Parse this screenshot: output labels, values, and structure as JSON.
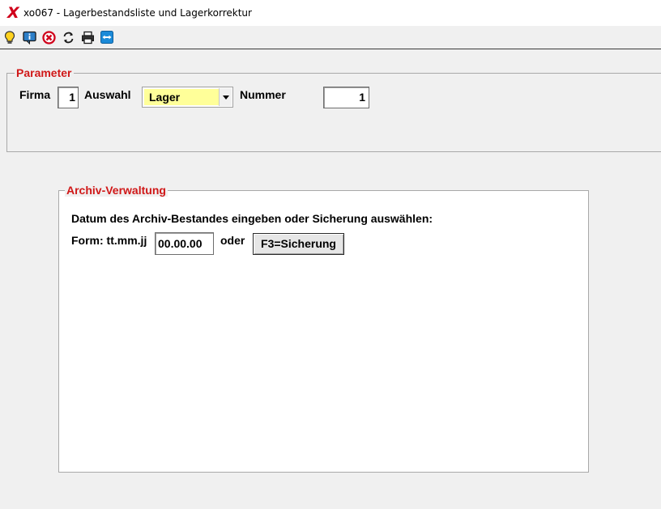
{
  "window": {
    "logo_glyph": "X",
    "title": "xo067 - Lagerbestandsliste und Lagerkorrektur"
  },
  "toolbar": {
    "icons": [
      "lightbulb-icon",
      "info-icon",
      "cancel-icon",
      "refresh-icon",
      "print-icon",
      "teamviewer-icon"
    ]
  },
  "parameter": {
    "legend": "Parameter",
    "firma_label": "Firma",
    "firma_value": "1",
    "auswahl_label": "Auswahl",
    "auswahl_value": "Lager",
    "nummer_label": "Nummer",
    "nummer_value": "1"
  },
  "archive": {
    "legend": "Archiv-Verwaltung",
    "instruction": "Datum des Archiv-Bestandes eingeben oder Sicherung auswählen:",
    "format_label": "Form: tt.mm.jj",
    "date_value": "00.00.00",
    "or_label": "oder",
    "button_label": "F3=Sicherung"
  },
  "colors": {
    "legend": "#d01818",
    "combo_highlight": "#ffff99",
    "background": "#f0f0f0"
  }
}
